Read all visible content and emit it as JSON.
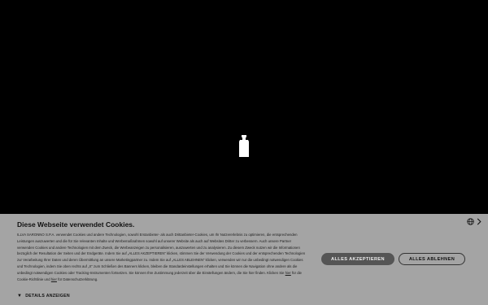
{
  "banner": {
    "title": "Diese Webseite verwendet Cookies.",
    "body_part1": "ILLVA SARONNO S.P.A. verwendet Cookies und andere Technologien, sowohl Erstanbieter- als auch Drittanbieter-Cookies, um Ihr Nutzererlebnis zu optimieren, die entsprechenden Leistungen auszuwerten und die für Sie relevanten Inhalte und Werbemaßnahmen sowohl auf unserer Website als auch auf Websites Dritter zu verbessern. Auch unsere Partner verwenden Cookies und andere Technologien mit dem Zweck, die Werbeanzeigen zu personalisieren, auszuwerten und zu analysieren. Zu diesem Zweck nutzen wir die Informationen bezüglich der Resultation der Seiten und der Endgeräte. Indem Sie auf „ALLES AKZEPTIEREN“ klicken, stimmen Sie der Verwendung der Cookies und der entsprechenden Technologien zur Verarbeitung Ihrer Daten und deren Übermittlung an unsere Marketingpartner zu. Indem Sie auf „ALLES ABLEHNEN“ klicken, verwenden wir nur die unbedingt notwendigen Cookies und Technologien, indem Sie oben rechts auf „X“ zum Schließen des Banners klicken, bleiben die Standardeinstellungen erhalten und Sie können die Navigation ohne andere als die unbedingt notwendigen Cookies oder Tracking-Instrumenten fortsetzen. Sie können Ihre Zustimmung jederzeit über die Einstellungen ändern, die Sie hier finden. Klicken Sie ",
    "link_hier": "hier",
    "body_part2": " für die Cookie-Richtlinie und ",
    "link_hier2": "hier",
    "body_part3": " für Datenschutzerklärung.",
    "details_label": "DETAILS ANZEIGEN",
    "accept_label": "ALLES AKZEPTIEREN",
    "reject_label": "ALLES ABLEHNEN",
    "language_icon": "globe-icon",
    "next_icon": "chevron-right-icon"
  },
  "colors": {
    "background": "#000000",
    "banner": "#a4a4a4",
    "accept_button": "#555555"
  }
}
